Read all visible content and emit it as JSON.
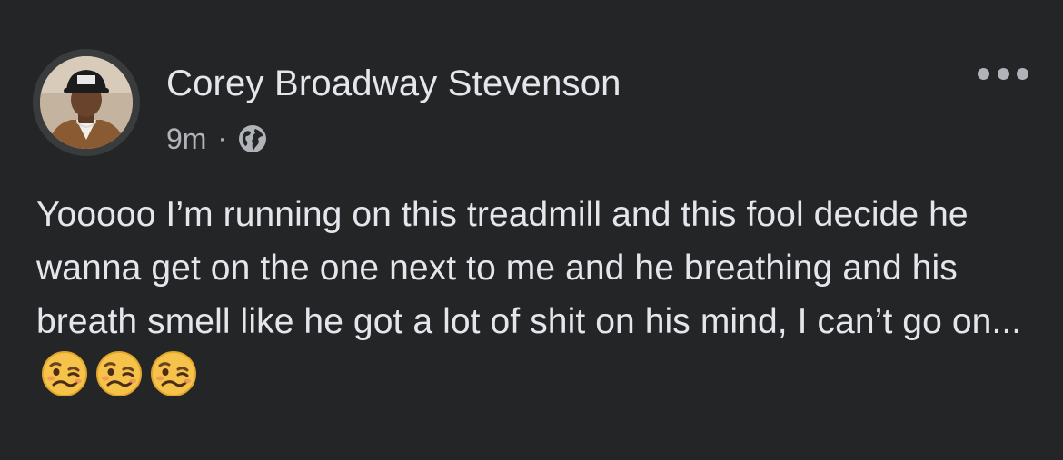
{
  "post": {
    "author": "Corey Broadway Stevenson",
    "timestamp": "9m",
    "separator": "·",
    "privacy_icon": "globe-icon",
    "menu_icon": "more-options-icon",
    "text": "Yooooo I’m running on this treadmill and this fool decide he wanna get on the one next to me and he breathing and his breath smell like he got a lot of shit on his mind, I can’t go on...",
    "emojis": [
      "woozy-face-icon",
      "woozy-face-icon",
      "woozy-face-icon"
    ]
  },
  "colors": {
    "background": "#242526",
    "primary_text": "#e4e6eb",
    "secondary_text": "#b0b3b8",
    "emoji_yellow": "#f6c34a"
  }
}
